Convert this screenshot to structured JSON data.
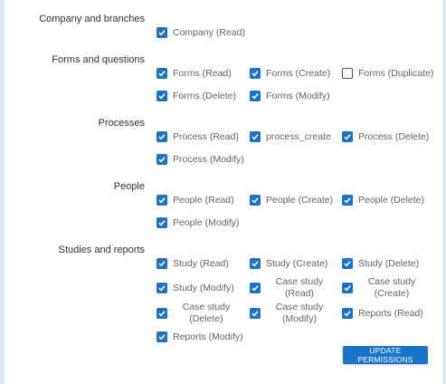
{
  "sections": [
    {
      "title": "Company and branches",
      "items": [
        {
          "label": "Company (Read)",
          "checked": true
        }
      ]
    },
    {
      "title": "Forms and questions",
      "items": [
        {
          "label": "Forms (Read)",
          "checked": true
        },
        {
          "label": "Forms (Create)",
          "checked": true
        },
        {
          "label": "Forms (Duplicate)",
          "checked": false
        },
        {
          "label": "Forms (Delete)",
          "checked": true
        },
        {
          "label": "Forms (Modify)",
          "checked": true
        }
      ]
    },
    {
      "title": "Processes",
      "items": [
        {
          "label": "Process (Read)",
          "checked": true
        },
        {
          "label": "process_create",
          "checked": true
        },
        {
          "label": "Process (Delete)",
          "checked": true
        },
        {
          "label": "Process (Modify)",
          "checked": true
        }
      ]
    },
    {
      "title": "People",
      "items": [
        {
          "label": "People (Read)",
          "checked": true
        },
        {
          "label": "People (Create)",
          "checked": true
        },
        {
          "label": "People (Delete)",
          "checked": true
        },
        {
          "label": "People (Modify)",
          "checked": true
        }
      ]
    },
    {
      "title": "Studies and reports",
      "items": [
        {
          "label": "Study (Read)",
          "checked": true
        },
        {
          "label": "Study (Create)",
          "checked": true
        },
        {
          "label": "Study (Delete)",
          "checked": true
        },
        {
          "label": "Study (Modify)",
          "checked": true
        },
        {
          "label": "Case study (Read)",
          "checked": true
        },
        {
          "label": "Case study (Create)",
          "checked": true
        },
        {
          "label": "Case study (Delete)",
          "checked": true
        },
        {
          "label": "Case study (Modify)",
          "checked": true
        },
        {
          "label": "Reports (Read)",
          "checked": true
        },
        {
          "label": "Reports (Modify)",
          "checked": true
        }
      ]
    }
  ],
  "update_button_label": "UPDATE PERMISSIONS",
  "colors": {
    "accent": "#1a73c8",
    "button": "#1b74cc"
  }
}
